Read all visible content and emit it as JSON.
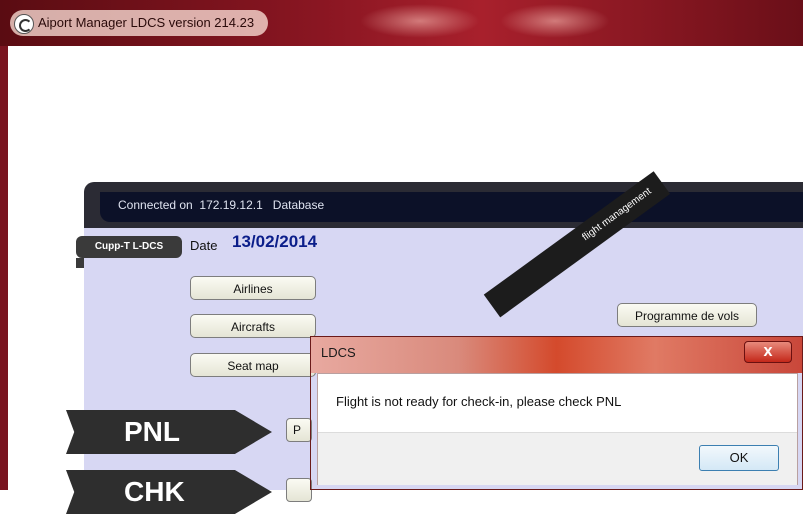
{
  "window": {
    "title": "Aiport Manager LDCS  version 214.23"
  },
  "connection": {
    "text": "Connected on  172.19.12.1   Database"
  },
  "session": {
    "badge": "Cupp-T L-DCS",
    "date_label": "Date",
    "date_value": "13/02/2014"
  },
  "menu": {
    "airlines": "Airlines",
    "aircrafts": "Aircrafts",
    "seat_map": "Seat map",
    "programme": "Programme de vols"
  },
  "section": {
    "diagonal_label": "flight management",
    "pnl": "PNL",
    "chk": "CHK",
    "pnl_button": "P"
  },
  "dialog": {
    "title": "LDCS",
    "close": "X",
    "message": "Flight is not ready for check-in, please check PNL",
    "ok": "OK"
  },
  "colors": {
    "titlebar": "#8a1622",
    "connection_bar": "#0c1128",
    "panel": "#d7d7f3",
    "date": "#0b1e8a"
  }
}
